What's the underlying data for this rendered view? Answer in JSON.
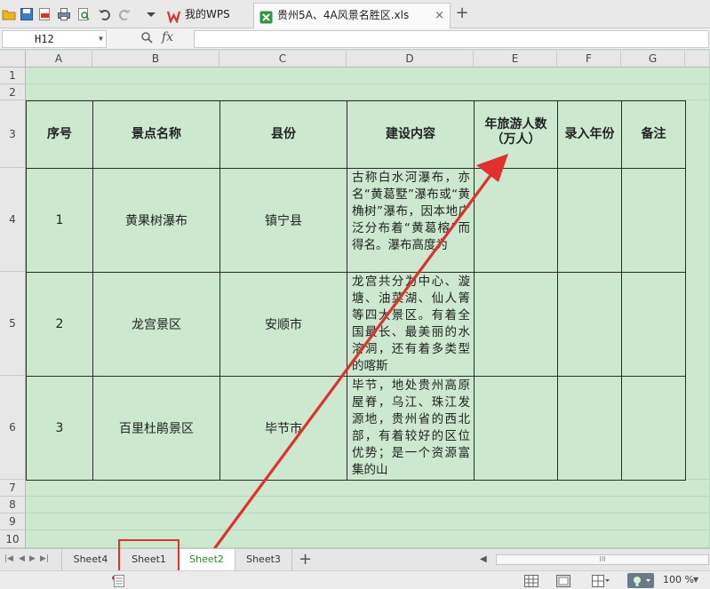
{
  "tabs": {
    "wps_label": "我的WPS",
    "file_label": "贵州5A、4A风景名胜区.xls",
    "close_glyph": "×",
    "new_tab_glyph": "+"
  },
  "formula_bar": {
    "cell_ref": "H12",
    "fx_label": "fx",
    "content": ""
  },
  "columns": [
    "A",
    "B",
    "C",
    "D",
    "E",
    "F",
    "G"
  ],
  "rows": [
    "1",
    "2",
    "3",
    "4",
    "5",
    "6",
    "7",
    "8",
    "9",
    "10"
  ],
  "table": {
    "headers": {
      "seq": "序号",
      "name": "景点名称",
      "county": "县份",
      "content": "建设内容",
      "visitors_line1": "年旅游人数",
      "visitors_line2": "（万人）",
      "year": "录入年份",
      "note": "备注"
    },
    "rows": [
      {
        "seq": "1",
        "name": "黄果树瀑布",
        "county": "镇宁县",
        "content": "古称白水河瀑布，亦名“黄葛墅”瀑布或“黄桷树”瀑布，因本地广泛分布着“黄葛榕”而得名。瀑布高度为"
      },
      {
        "seq": "2",
        "name": "龙宫景区",
        "county": "安顺市",
        "content": "龙宫共分为中心、漩塘、油菜湖、仙人箐等四大景区。有着全国最长、最美丽的水溶洞，还有着多类型的喀斯"
      },
      {
        "seq": "3",
        "name": "百里杜鹃景区",
        "county": "毕节市",
        "content": "毕节，地处贵州高原屋脊，乌江、珠江发源地，贵州省的西北部，有着较好的区位优势；是一个资源富集的山"
      }
    ]
  },
  "sheets": [
    "Sheet4",
    "Sheet1",
    "Sheet2",
    "Sheet3"
  ],
  "active_sheet": "Sheet2",
  "highlighted_sheet": "Sheet1",
  "add_sheet_glyph": "+",
  "scroll_thumb_glyph": "III",
  "status": {
    "zoom": "100 %"
  },
  "colors": {
    "grid_bg": "#cce8cf",
    "table_border": "#2a2a2a",
    "annotation_red": "#e0312f",
    "active_tab_text": "#2e8b2e"
  }
}
